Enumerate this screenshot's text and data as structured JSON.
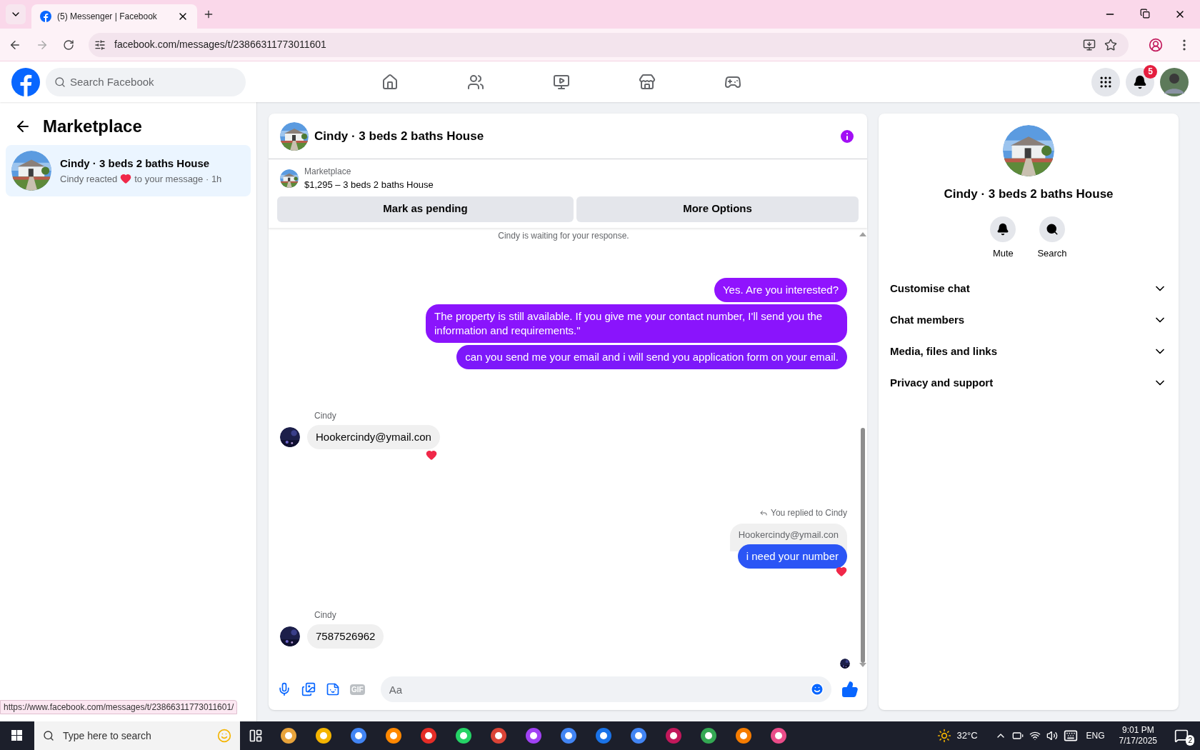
{
  "browser": {
    "tab": {
      "title": "(5) Messenger | Facebook"
    },
    "url": "facebook.com/messages/t/23866311773011601",
    "status_url": "https://www.facebook.com/messages/t/23866311773011601/"
  },
  "header": {
    "search_placeholder": "Search Facebook",
    "notifications_count": "5"
  },
  "sidebar": {
    "title": "Marketplace",
    "conversations": [
      {
        "name": "Cindy · 3 beds 2 baths House",
        "preview_before": "Cindy reacted",
        "preview_after": "to your message · 1h",
        "selected": true
      }
    ]
  },
  "chat": {
    "title": "Cindy · 3 beds 2 baths House",
    "listing": {
      "source": "Marketplace",
      "summary": "$1,295 – 3 beds 2 baths House"
    },
    "actions": [
      "Mark as pending",
      "More Options"
    ],
    "messages": [
      {
        "kind": "status",
        "text": "Cindy is waiting for your response."
      },
      {
        "kind": "sent",
        "text": "Yes. Are you interested?",
        "color": "#9013fe",
        "reacted": false
      },
      {
        "kind": "sent",
        "text": "The property is still available. If you give me your contact number, I'll send you the information and requirements.\"",
        "color": "#8a14fc",
        "reacted": false
      },
      {
        "kind": "sent",
        "text": "can you send me your email and i will send you application form on your email.",
        "color": "#7d18fa",
        "reacted": false
      },
      {
        "kind": "received",
        "sender": "Cindy",
        "text": "Hookercindy@ymail.con",
        "reacted": true
      },
      {
        "kind": "reply",
        "note": "You replied to Cindy",
        "quote": "Hookercindy@ymail.con",
        "text": "i need your number",
        "color": "#2b55f5",
        "reacted": true
      },
      {
        "kind": "received",
        "sender": "Cindy",
        "text": "7587526962",
        "reacted": false
      }
    ],
    "composer": {
      "gif_label": "GIF",
      "placeholder": "Aa"
    }
  },
  "info": {
    "title": "Cindy · 3 beds 2 baths House",
    "actions": [
      "Mute",
      "Search"
    ],
    "sections": [
      {
        "label": "Customise chat",
        "expanded": false
      },
      {
        "label": "Chat members",
        "expanded": false
      },
      {
        "label": "Media, files and links",
        "expanded": false
      },
      {
        "label": "Privacy and support",
        "expanded": false
      }
    ]
  },
  "taskbar": {
    "search_placeholder": "Type here to search",
    "temperature": "32°C",
    "language": "ENG",
    "time": "9:01 PM",
    "date": "7/17/2025",
    "notifications": "2"
  }
}
